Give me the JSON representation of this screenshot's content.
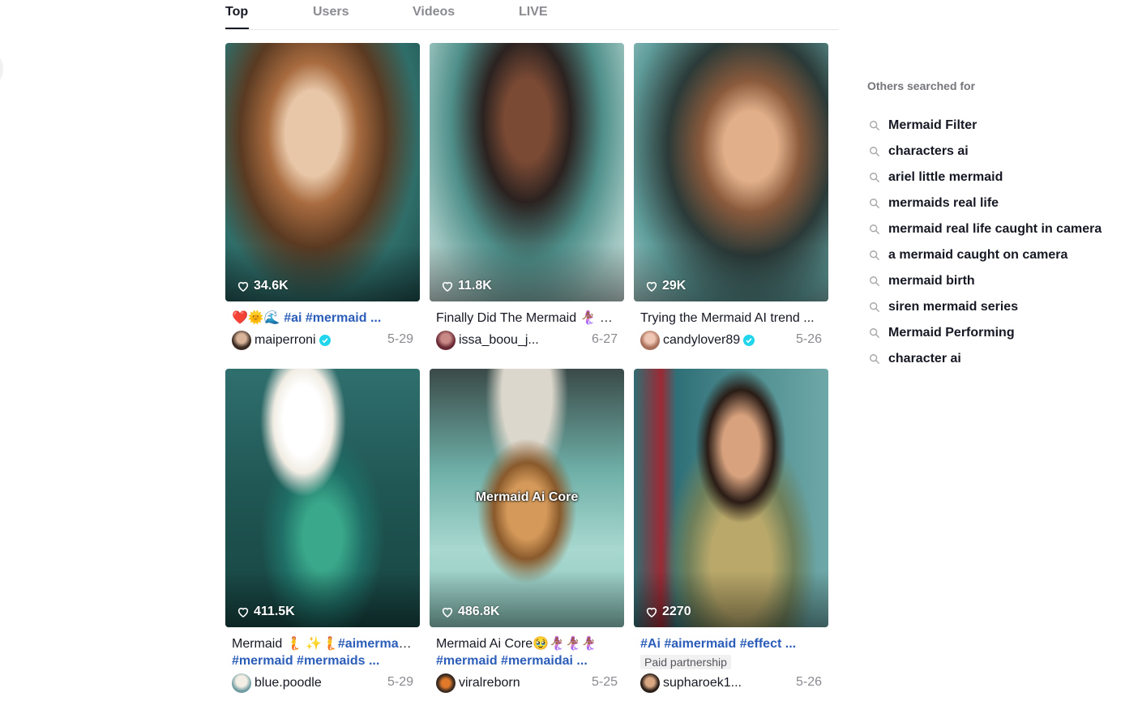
{
  "tabs": [
    {
      "label": "Top",
      "active": true
    },
    {
      "label": "Users",
      "active": false
    },
    {
      "label": "Videos",
      "active": false
    },
    {
      "label": "LIVE",
      "active": false
    }
  ],
  "videos": [
    {
      "likes": "34.6K",
      "caption_prefix": "❤️🌞🌊 ",
      "caption_tags": "#ai #mermaid ...",
      "caption_text": "",
      "username": "maiperroni",
      "verified": true,
      "date": "5-29"
    },
    {
      "likes": "11.8K",
      "caption_prefix": "",
      "caption_tags": "",
      "caption_text": "Finally Did The Mermaid 🧜🏾‍♀️ C...",
      "username": "issa_boou_j...",
      "verified": false,
      "date": "6-27"
    },
    {
      "likes": "29K",
      "caption_prefix": "",
      "caption_tags": "",
      "caption_text": "Trying the Mermaid AI trend ...",
      "username": "candylover89",
      "verified": true,
      "date": "5-26"
    },
    {
      "likes": "411.5K",
      "caption_prefix": "Mermaid 🧜 ✨🧜",
      "caption_tags": "#aimermaid...",
      "caption_line2": "#mermaid #mermaids ...",
      "username": "blue.poodle",
      "verified": false,
      "date": "5-29"
    },
    {
      "likes": "486.8K",
      "overlay": "Mermaid Ai Core",
      "caption_prefix": "Mermaid Ai Core🥹🧜🏾‍♀️🧜🏾‍♀️🧜🏾‍♀️",
      "caption_tags": "",
      "caption_line2": "#mermaid #mermaidai ...",
      "username": "viralreborn",
      "verified": false,
      "date": "5-25"
    },
    {
      "likes": "2270",
      "caption_prefix": "",
      "caption_tags": "#Ai #aimermaid #effect ...",
      "caption_text": "",
      "paid": "Paid partnership",
      "username": "supharoek1...",
      "verified": false,
      "date": "5-26"
    }
  ],
  "sidebar": {
    "title": "Others searched for",
    "items": [
      "Mermaid Filter",
      "characters ai",
      "ariel little mermaid",
      "mermaids real life",
      "mermaid real life caught in camera",
      "a mermaid caught on camera",
      "mermaid birth",
      "siren mermaid series",
      "Mermaid Performing",
      "character ai"
    ]
  },
  "colors": {
    "accent_tag": "#2b5db9",
    "verified": "#20d5ec",
    "text": "#161823",
    "muted": "#8a8b91"
  }
}
